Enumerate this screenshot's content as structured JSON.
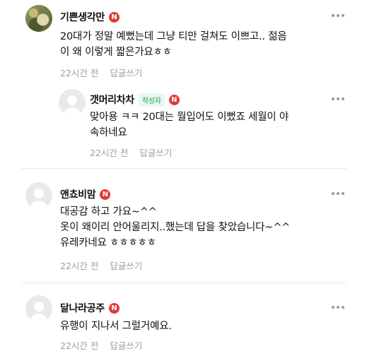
{
  "comments": [
    {
      "author": "기쁜생각만",
      "badge": "N",
      "text_lines": [
        "20대가 정말 예뻤는데 그냥 티만 걸쳐도 이쁘고.. 젊음",
        "이 왜 이렇게 짧은가요ㅎㅎ"
      ],
      "time": "22시간 전",
      "reply_label": "답글쓰기"
    },
    {
      "author": "갯머리차차",
      "author_tag": "작성자",
      "badge": "N",
      "text_lines": [
        "맞아용 ㅋㅋ 20대는 뭘입어도 이뻤죠 세월이 야",
        "속하네요"
      ],
      "time": "22시간 전",
      "reply_label": "답글쓰기"
    },
    {
      "author": "앤쵸비맘",
      "badge": "N",
      "text_lines": [
        "대공감 하고 가요~^^",
        "옷이 왜이리 안어울리지..했는데 답을 찾았습니다~^^",
        "유레카네요 ㅎㅎㅎㅎㅎ"
      ],
      "time": "22시간 전",
      "reply_label": "답글쓰기"
    },
    {
      "author": "달나라공주",
      "badge": "N",
      "text_lines": [
        "유행이 지나서 그럴거예요."
      ],
      "time": "22시간 전",
      "reply_label": "답글쓰기"
    }
  ],
  "colors": {
    "badge": "#e53935",
    "author_tag_text": "#1aa35f",
    "meta": "#9e9e9e"
  },
  "icons": {
    "more": "more-dots-icon",
    "avatar_default": "default-avatar-icon"
  }
}
